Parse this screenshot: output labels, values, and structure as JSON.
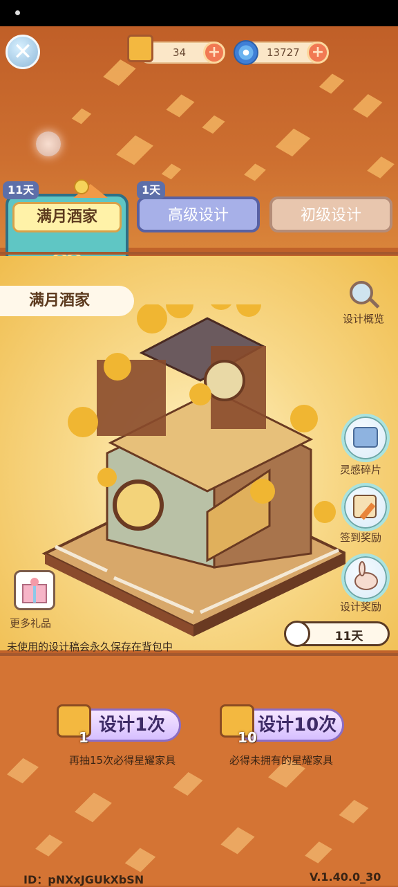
{
  "header": {
    "close_icon": "close-icon",
    "currencies": [
      {
        "icon": "design-scroll-icon",
        "value": "34"
      },
      {
        "icon": "swirl-coin-icon",
        "value": "13727"
      }
    ]
  },
  "tabs": [
    {
      "label": "满月酒家",
      "days": "11天",
      "active": true
    },
    {
      "label": "高级设计",
      "days": "1天",
      "active": false
    },
    {
      "label": "初级设计",
      "days": "",
      "active": false
    }
  ],
  "panel": {
    "title": "满月酒家",
    "overview_label": "设计概览",
    "side_buttons": [
      {
        "label": "灵感碎片",
        "icon": "blueprint-icon"
      },
      {
        "label": "签到奖励",
        "icon": "calendar-pencil-icon"
      },
      {
        "label": "设计奖励",
        "icon": "rabbit-icon"
      }
    ],
    "gift_label": "更多礼品",
    "hint": "未使用的设计稿会永久保存在背包中",
    "timer": "11天"
  },
  "draws": [
    {
      "count": "1",
      "label": "设计1次",
      "sub": "再抽15次必得星耀家具"
    },
    {
      "count": "10",
      "label": "设计10次",
      "sub": "必得未拥有的星耀家具"
    }
  ],
  "footer": {
    "id": "ID：pNXxJGUkXbSN",
    "version": "V.1.40.0_30"
  },
  "colors": {
    "background_top": "#c05f28",
    "tab_active": "#5fc6c4",
    "tab_advanced": "#a7b0e8",
    "tab_basic": "#e8c6ae",
    "draw_button": "#d6bfff"
  }
}
